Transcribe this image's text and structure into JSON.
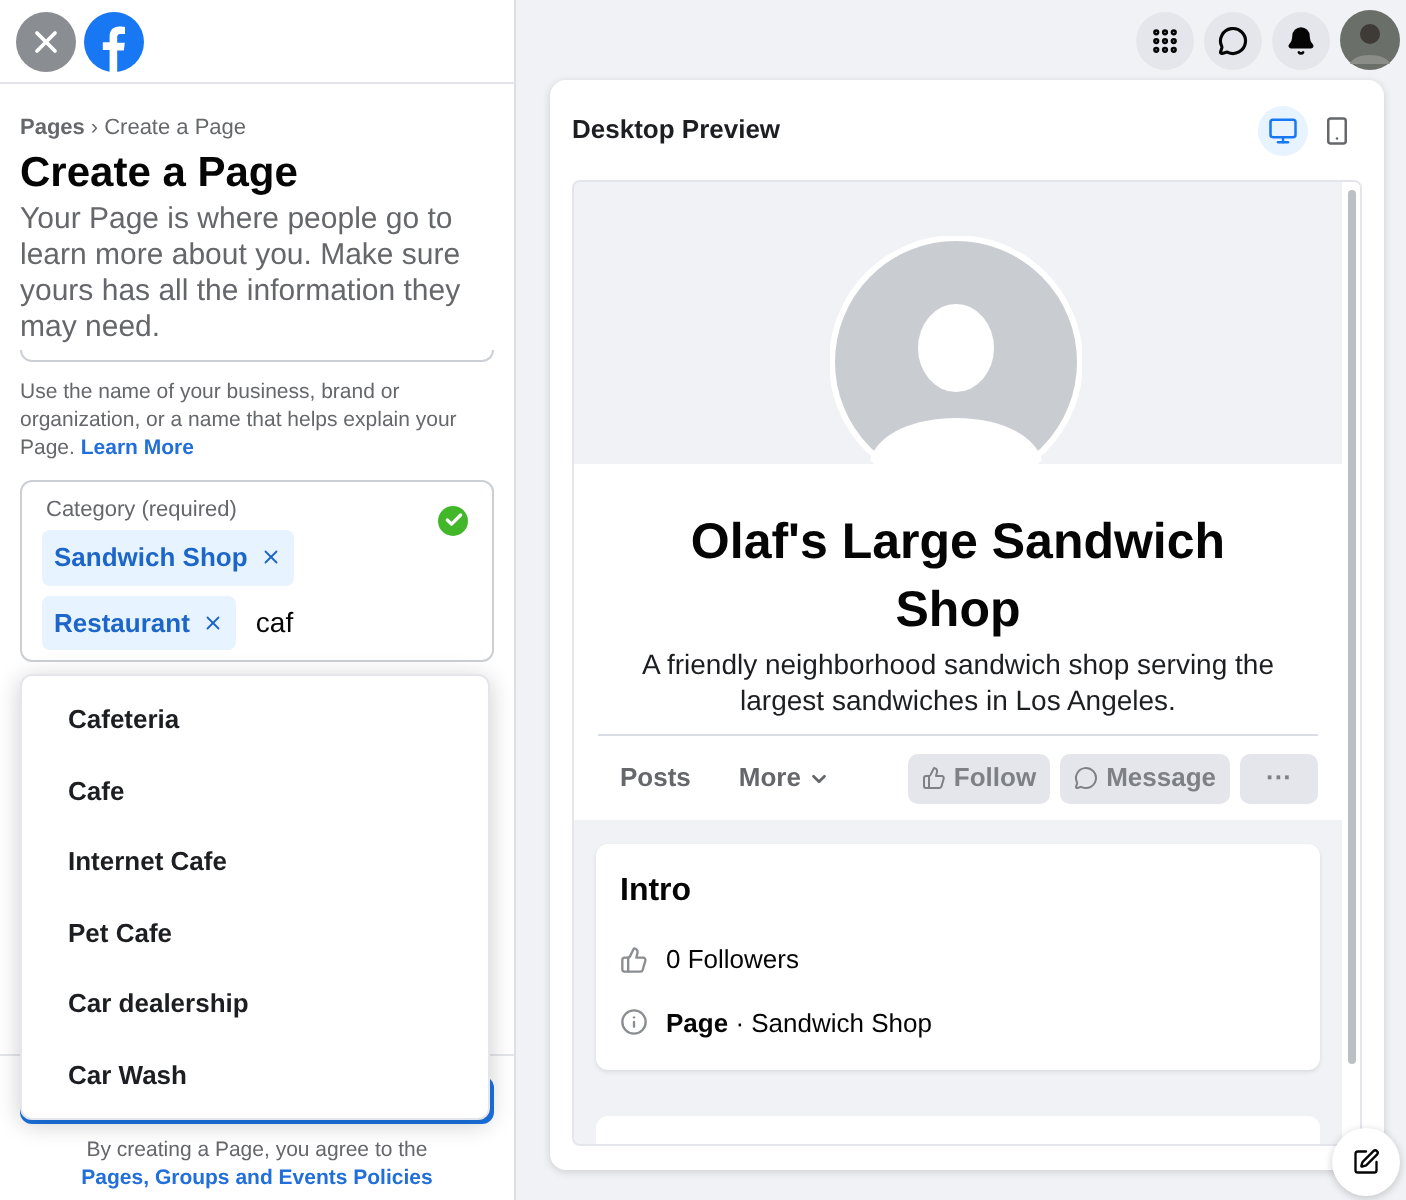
{
  "breadcrumb": {
    "parent": "Pages",
    "separator": "›",
    "current": "Create a Page"
  },
  "title": "Create a Page",
  "intro": "Your Page is where people go to learn more about you. Make sure yours has all the information they may need.",
  "name_help": {
    "text": "Use the name of your business, brand or organization, or a name that helps explain your Page.",
    "link": "Learn More"
  },
  "category": {
    "label": "Category (required)",
    "valid": true,
    "tags": [
      "Sandwich Shop",
      "Restaurant"
    ],
    "value": "caf"
  },
  "suggestions": [
    {
      "label": "Cafeteria"
    },
    {
      "label": "Cafe"
    },
    {
      "label": "Internet Cafe"
    },
    {
      "label": "Pet Cafe"
    },
    {
      "label": "Car dealership"
    },
    {
      "label": "Car Wash"
    }
  ],
  "terms": {
    "text": "By creating a Page, you agree to the",
    "link": "Pages, Groups and Events Policies"
  },
  "preview": {
    "title": "Desktop Preview",
    "modes": [
      {
        "kind": "desktop",
        "selected": true
      },
      {
        "kind": "mobile",
        "selected": false
      }
    ],
    "page_name": "Olaf's Large Sandwich Shop",
    "description": "A friendly neighborhood sandwich shop serving the largest sandwiches in Los Angeles.",
    "tabs": [
      "Posts",
      "More"
    ],
    "actions": [
      {
        "kind": "follow",
        "label": "Follow"
      },
      {
        "kind": "message",
        "label": "Message"
      },
      {
        "kind": "more",
        "label": "···"
      }
    ],
    "intro": {
      "title": "Intro",
      "items": [
        {
          "kind": "followers",
          "text": "0 Followers"
        },
        {
          "kind": "info",
          "text": "**Page** · Sandwich Shop"
        }
      ]
    }
  }
}
